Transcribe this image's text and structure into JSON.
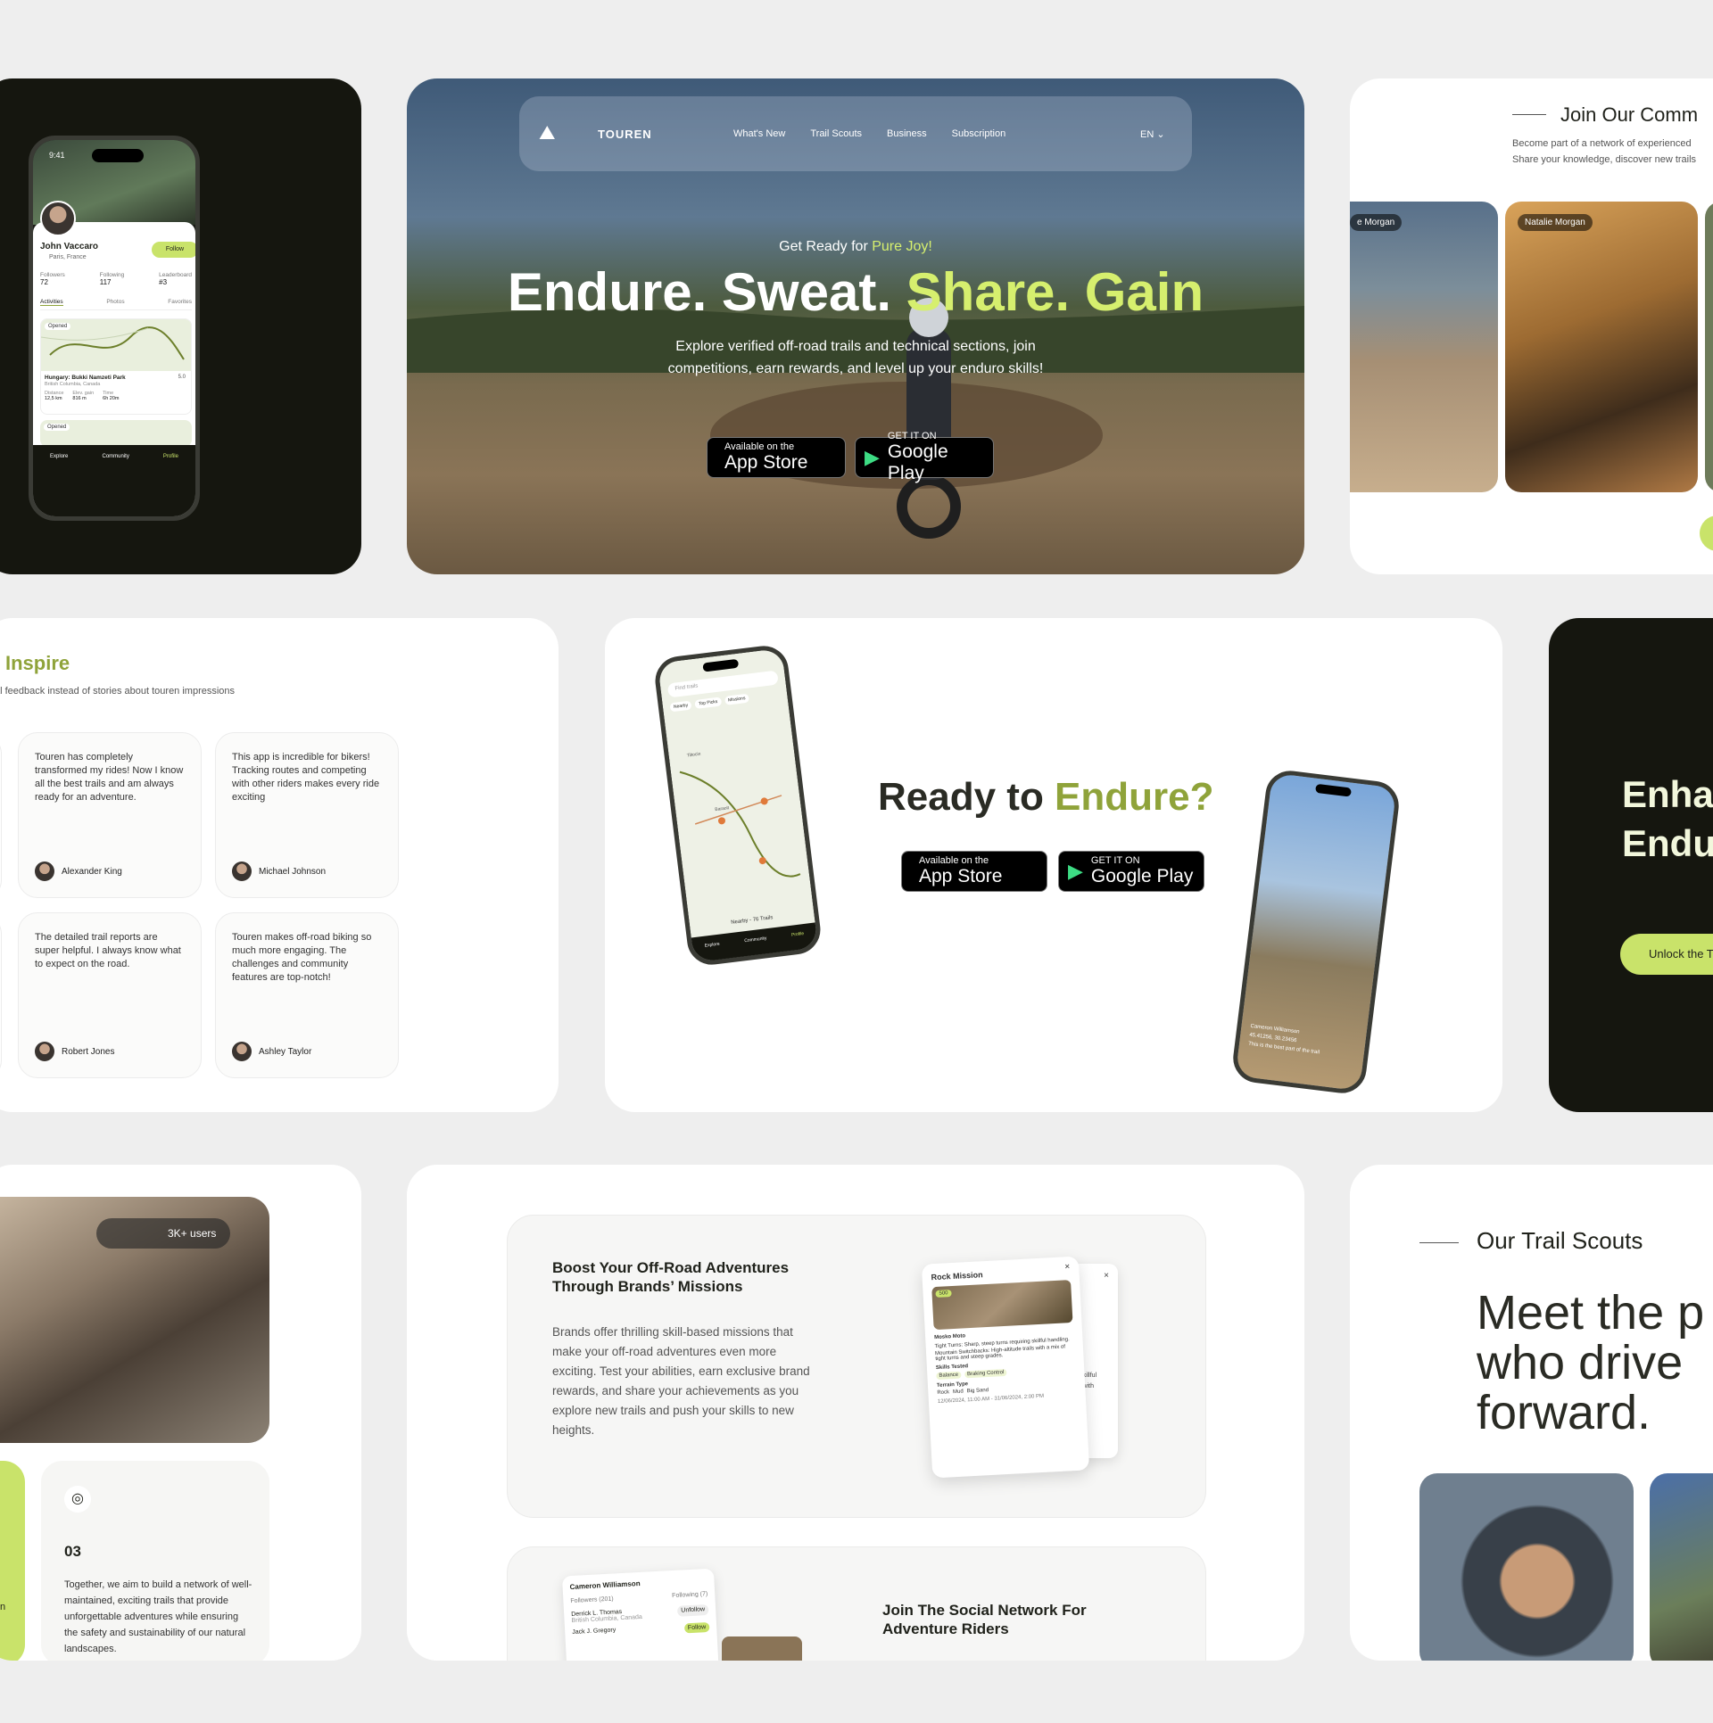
{
  "profile_card": {
    "time": "9:41",
    "name": "John Vaccaro",
    "location": "Paris, France",
    "follow": "Follow",
    "stats": [
      {
        "label": "Followers",
        "value": "72"
      },
      {
        "label": "Following",
        "value": "117"
      },
      {
        "label": "Leaderboard",
        "value": "#3"
      }
    ],
    "tabs": [
      "Activities",
      "Photos",
      "Favorites"
    ],
    "badge": "Opened",
    "trail_name": "Hungary: Bukki Namzeti Park",
    "trail_region": "British Columbia, Canada",
    "rating": "5.0",
    "metrics": [
      {
        "label": "Distance",
        "value": "12,5 km"
      },
      {
        "label": "Elev. gain",
        "value": "816 m"
      },
      {
        "label": "Time",
        "value": "6h 20m"
      }
    ],
    "badge2": "Opened",
    "nav": [
      "Explore",
      "Community",
      "Profile"
    ]
  },
  "hero": {
    "logo": "TOUREN",
    "nav": [
      "What's New",
      "Trail Scouts",
      "Business",
      "Subscription"
    ],
    "lang": "EN",
    "eyebrow_a": "Get Ready for ",
    "eyebrow_b": "Pure Joy!",
    "title_a": "Endure. Sweat. ",
    "title_b": "Share. Gain",
    "subtitle_1": "Explore verified off-road trails and technical sections, join",
    "subtitle_2": "competitions, earn rewards, and level up your enduro skills!",
    "app_small": "Available on the",
    "app_big": "App Store",
    "play_small": "GET IT ON",
    "play_big": "Google Play"
  },
  "community": {
    "title": "Join Our Comm",
    "text_1": "Become part of a network of experienced",
    "text_2": "Share your knowledge, discover new trails",
    "label_1": "e Morgan",
    "label_2": "Natalie Morgan"
  },
  "inspire": {
    "title": "Inspire",
    "subtitle": "al feedback instead of stories about touren impressions",
    "cards": [
      {
        "text": "Touren has completely transformed my rides! Now I know all the best trails and am always ready for an adventure.",
        "name": "Alexander King"
      },
      {
        "text": "This app is incredible for bikers! Tracking routes and competing with other riders makes every ride exciting",
        "name": "Michael Johnson"
      },
      {
        "text": "The detailed trail reports are super helpful. I always know what to expect on the road.",
        "name": "Robert Jones"
      },
      {
        "text": "Touren makes off-road biking so much more engaging. The challenges and community features are top-notch!",
        "name": "Ashley Taylor"
      }
    ]
  },
  "ready": {
    "title_a": "Ready to ",
    "title_b": "Endure?",
    "app_small": "Available on the",
    "app_big": "App Store",
    "play_small": "GET IT ON",
    "play_big": "Google Play",
    "map_search": "Find trails",
    "map_chips": [
      "Nearby",
      "Top Picks",
      "Missions"
    ],
    "map_places": [
      "Tiltocin",
      "Baraolt"
    ],
    "map_footer": "Nearby - 76 Trails",
    "map_nav": [
      "Explore",
      "Community",
      "Profile"
    ],
    "ride_user": "Cameron Williamson",
    "ride_coords": "45.41256, 30.23456",
    "ride_caption": "This is the best part of the trail"
  },
  "enhance": {
    "line_1": "Enha",
    "line_2": "Endu",
    "button": "Unlock the T"
  },
  "network": {
    "users": "3K+ users",
    "number": "03",
    "text": "Together, we aim to build a network of well-maintained, exciting trails that provide unforgettable adventures while ensuring the safety and sustainability of our natural landscapes.",
    "edge_text": "n"
  },
  "missions": {
    "title": "Boost Your Off-Road Adventures Through Brands’ Missions",
    "text": "Brands offer thrilling skill-based missions that make your off-road adventures even more exciting. Test your abilities, earn exclusive brand rewards, and share your achievements as you explore new trails and push your skills to new heights.",
    "popup": {
      "title": "Rock Mission",
      "points": "500",
      "brand": "Mosko Moto",
      "line_1": "Tight Turns: Sharp, steep turns requiring skillful handling.",
      "line_2": "Mountain Switchbacks: High-altitude trails with a mix of tight turns and steep grades.",
      "skills_label": "Skills Tested",
      "skills": [
        "Balance",
        "Braking Control"
      ],
      "terrain_label": "Terrain Type",
      "terrain": [
        "Rock",
        "Mud",
        "Big Sand"
      ],
      "dates": "12/06/2024, 11:00 AM - 31/06/2024, 2:00 PM"
    },
    "back_popup": {
      "line_1": "uiring skillful",
      "line_2": "e trails with",
      "line_3": "s.",
      "line_4": "00 PM"
    },
    "social_title": "Join The Social Network For Adventure Riders",
    "social_user": "Cameron Williamson",
    "social_tabs": [
      "Followers (201)",
      "Following (7)"
    ],
    "social_rows": [
      {
        "name": "Derrick L. Thomas",
        "sub": "British Columbia, Canada",
        "btn": "Unfollow"
      },
      {
        "name": "Jack J. Gregory",
        "btn": "Follow"
      }
    ]
  },
  "scouts": {
    "eyebrow": "Our Trail Scouts",
    "title_1": "Meet the p",
    "title_2": "who drive",
    "title_3": "forward."
  },
  "colors": {
    "accent": "#c9e36a",
    "olive": "#8fa33a",
    "dark": "#15160f",
    "bg": "#eeeeee"
  }
}
